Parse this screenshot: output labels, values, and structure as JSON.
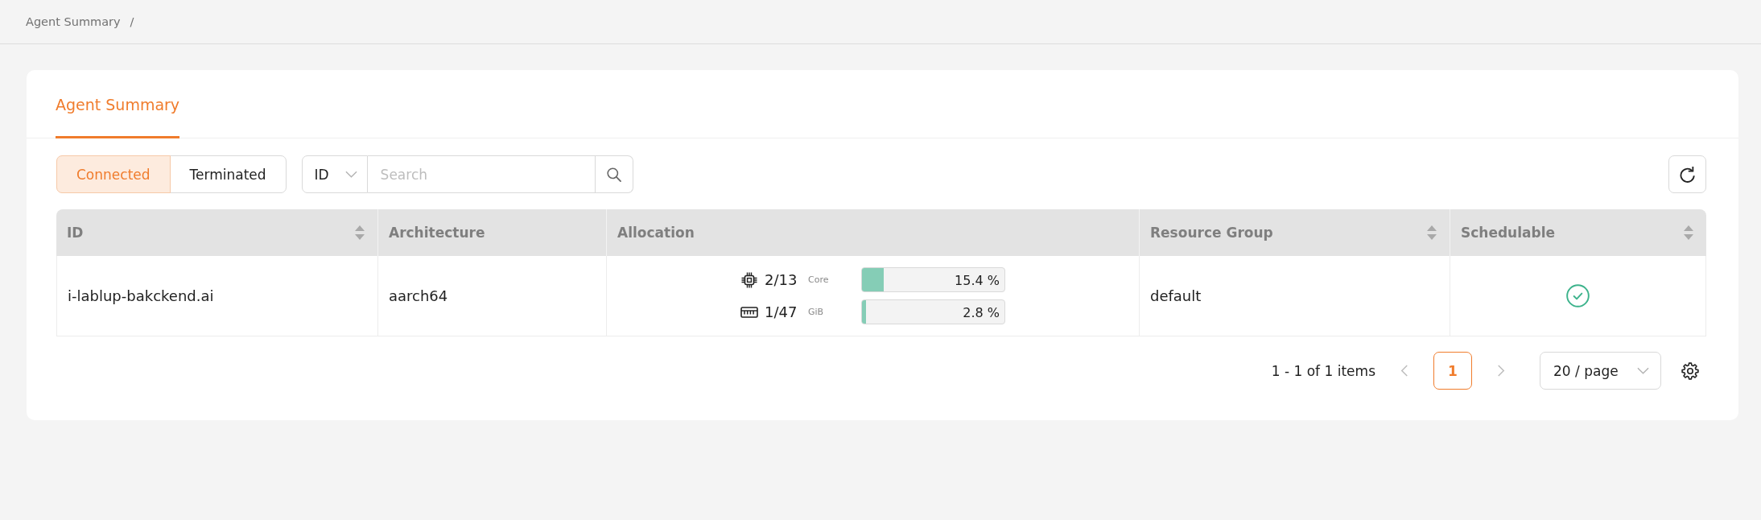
{
  "breadcrumb": {
    "items": [
      {
        "label": "Agent Summary"
      }
    ],
    "separator": "/"
  },
  "tabs": [
    {
      "label": "Agent Summary",
      "selected": true
    }
  ],
  "toolbar": {
    "status_filter": [
      {
        "label": "Connected",
        "selected": true
      },
      {
        "label": "Terminated",
        "selected": false
      }
    ],
    "search": {
      "field": "ID",
      "placeholder": "Search"
    }
  },
  "table": {
    "columns": [
      {
        "label": "ID",
        "sortable": true
      },
      {
        "label": "Architecture",
        "sortable": false
      },
      {
        "label": "Allocation",
        "sortable": false
      },
      {
        "label": "Resource Group",
        "sortable": true
      },
      {
        "label": "Schedulable",
        "sortable": true
      }
    ],
    "rows": [
      {
        "id": "i-lablup-bakckend.ai",
        "architecture": "aarch64",
        "allocation": [
          {
            "kind": "cpu",
            "amount": "2/13",
            "unit": "Core",
            "level": 0.154,
            "reading": "15.4 %"
          },
          {
            "kind": "memory",
            "amount": "1/47",
            "unit": "GiB",
            "level": 0.028,
            "reading": "2.8 %"
          }
        ],
        "resource_group": "default",
        "schedulable": true
      }
    ]
  },
  "pagination": {
    "summary": "1 - 1 of 1 items",
    "previous": {
      "disabled": true
    },
    "pages": [
      {
        "label": "1",
        "selected": true
      }
    ],
    "next": {
      "disabled": true
    },
    "page_size": "20 / page"
  }
}
